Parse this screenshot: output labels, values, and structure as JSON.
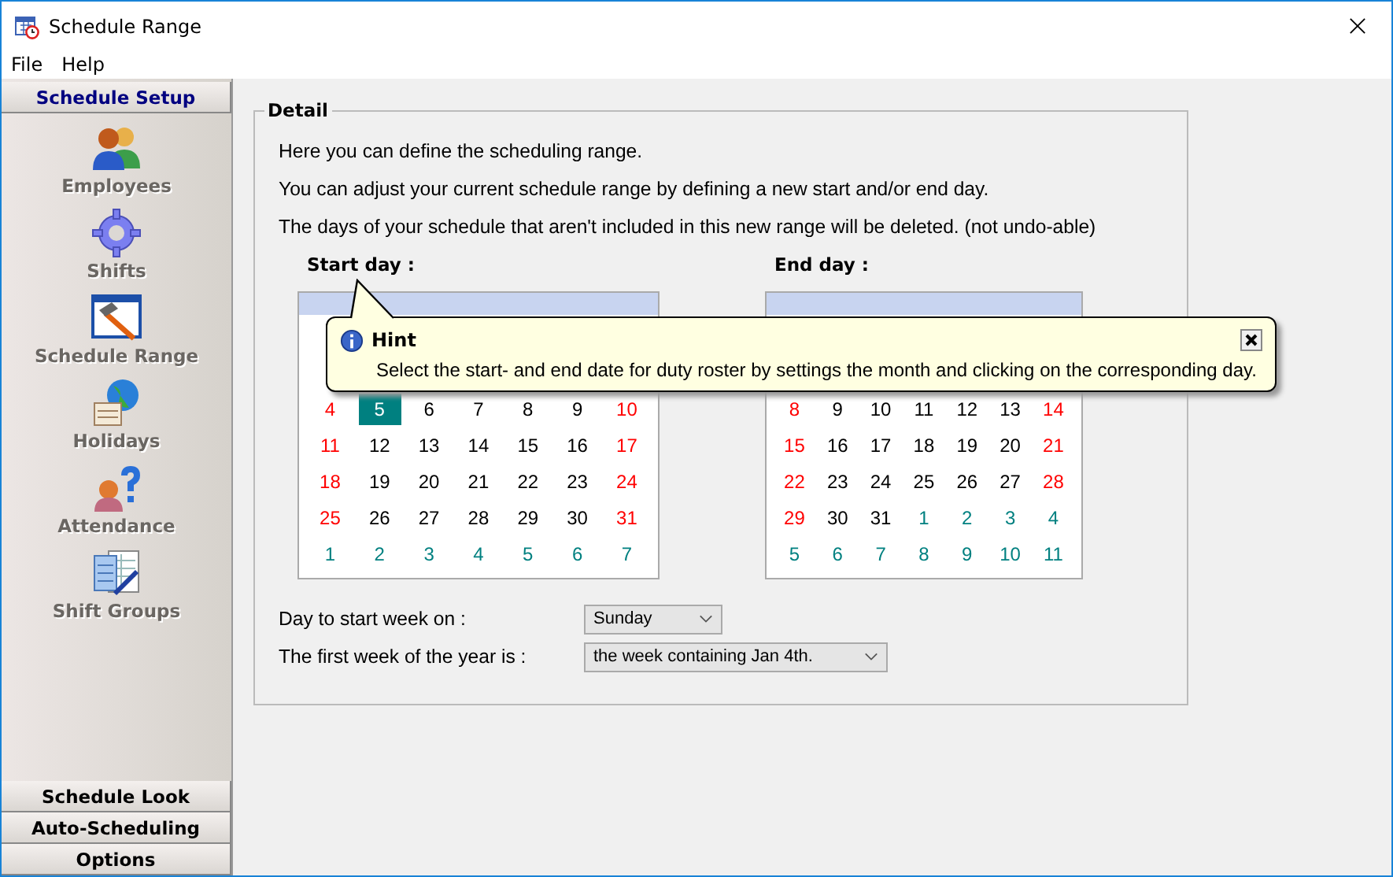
{
  "window": {
    "title": "Schedule Range"
  },
  "menu": [
    "File",
    "Help"
  ],
  "sidebar": {
    "header": "Schedule Setup",
    "items": [
      {
        "label": "Employees",
        "kind": "people"
      },
      {
        "label": "Shifts",
        "kind": "gear"
      },
      {
        "label": "Schedule Range",
        "kind": "hammer"
      },
      {
        "label": "Holidays",
        "kind": "globe"
      },
      {
        "label": "Attendance",
        "kind": "question"
      },
      {
        "label": "Shift Groups",
        "kind": "calc"
      }
    ],
    "sections": [
      "Schedule Look",
      "Auto-Scheduling",
      "Options"
    ]
  },
  "detail": {
    "title": "Detail",
    "lines": [
      "Here you can define the scheduling range.",
      "You can adjust your current schedule range by defining a new start and/or end day.",
      "The days of your schedule that aren't included in this new range will be deleted. (not undo-able)"
    ],
    "calendars": [
      {
        "label": "Start day :",
        "weeks": [
          [
            {
              "d": "4",
              "kind": "weekend",
              "selected": false
            },
            {
              "d": "5",
              "kind": "day",
              "selected": true
            },
            {
              "d": "6",
              "kind": "day",
              "selected": false
            },
            {
              "d": "7",
              "kind": "day",
              "selected": false
            },
            {
              "d": "8",
              "kind": "day",
              "selected": false
            },
            {
              "d": "9",
              "kind": "day",
              "selected": false
            },
            {
              "d": "10",
              "kind": "weekend",
              "selected": false
            }
          ],
          [
            {
              "d": "11",
              "kind": "weekend",
              "selected": false
            },
            {
              "d": "12",
              "kind": "day",
              "selected": false
            },
            {
              "d": "13",
              "kind": "day",
              "selected": false
            },
            {
              "d": "14",
              "kind": "day",
              "selected": false
            },
            {
              "d": "15",
              "kind": "day",
              "selected": false
            },
            {
              "d": "16",
              "kind": "day",
              "selected": false
            },
            {
              "d": "17",
              "kind": "weekend",
              "selected": false
            }
          ],
          [
            {
              "d": "18",
              "kind": "weekend",
              "selected": false
            },
            {
              "d": "19",
              "kind": "day",
              "selected": false
            },
            {
              "d": "20",
              "kind": "day",
              "selected": false
            },
            {
              "d": "21",
              "kind": "day",
              "selected": false
            },
            {
              "d": "22",
              "kind": "day",
              "selected": false
            },
            {
              "d": "23",
              "kind": "day",
              "selected": false
            },
            {
              "d": "24",
              "kind": "weekend",
              "selected": false
            }
          ],
          [
            {
              "d": "25",
              "kind": "weekend",
              "selected": false
            },
            {
              "d": "26",
              "kind": "day",
              "selected": false
            },
            {
              "d": "27",
              "kind": "day",
              "selected": false
            },
            {
              "d": "28",
              "kind": "day",
              "selected": false
            },
            {
              "d": "29",
              "kind": "day",
              "selected": false
            },
            {
              "d": "30",
              "kind": "day",
              "selected": false
            },
            {
              "d": "31",
              "kind": "weekend",
              "selected": false
            }
          ],
          [
            {
              "d": "1",
              "kind": "other",
              "selected": false
            },
            {
              "d": "2",
              "kind": "other",
              "selected": false
            },
            {
              "d": "3",
              "kind": "other",
              "selected": false
            },
            {
              "d": "4",
              "kind": "other",
              "selected": false
            },
            {
              "d": "5",
              "kind": "other",
              "selected": false
            },
            {
              "d": "6",
              "kind": "other",
              "selected": false
            },
            {
              "d": "7",
              "kind": "other",
              "selected": false
            }
          ]
        ]
      },
      {
        "label": "End day :",
        "weeks": [
          [
            {
              "d": "8",
              "kind": "weekend",
              "selected": false
            },
            {
              "d": "9",
              "kind": "day",
              "selected": false
            },
            {
              "d": "10",
              "kind": "day",
              "selected": false
            },
            {
              "d": "11",
              "kind": "day",
              "selected": false
            },
            {
              "d": "12",
              "kind": "day",
              "selected": false
            },
            {
              "d": "13",
              "kind": "day",
              "selected": false
            },
            {
              "d": "14",
              "kind": "weekend",
              "selected": false
            }
          ],
          [
            {
              "d": "15",
              "kind": "weekend",
              "selected": false
            },
            {
              "d": "16",
              "kind": "day",
              "selected": false
            },
            {
              "d": "17",
              "kind": "day",
              "selected": false
            },
            {
              "d": "18",
              "kind": "day",
              "selected": false
            },
            {
              "d": "19",
              "kind": "day",
              "selected": false
            },
            {
              "d": "20",
              "kind": "day",
              "selected": false
            },
            {
              "d": "21",
              "kind": "weekend",
              "selected": false
            }
          ],
          [
            {
              "d": "22",
              "kind": "weekend",
              "selected": false
            },
            {
              "d": "23",
              "kind": "day",
              "selected": false
            },
            {
              "d": "24",
              "kind": "day",
              "selected": false
            },
            {
              "d": "25",
              "kind": "day",
              "selected": false
            },
            {
              "d": "26",
              "kind": "day",
              "selected": false
            },
            {
              "d": "27",
              "kind": "day",
              "selected": false
            },
            {
              "d": "28",
              "kind": "weekend",
              "selected": false
            }
          ],
          [
            {
              "d": "29",
              "kind": "weekend",
              "selected": false
            },
            {
              "d": "30",
              "kind": "day",
              "selected": false
            },
            {
              "d": "31",
              "kind": "day",
              "selected": false
            },
            {
              "d": "1",
              "kind": "other",
              "selected": false
            },
            {
              "d": "2",
              "kind": "other",
              "selected": false
            },
            {
              "d": "3",
              "kind": "other",
              "selected": false
            },
            {
              "d": "4",
              "kind": "other",
              "selected": false
            }
          ],
          [
            {
              "d": "5",
              "kind": "other",
              "selected": false
            },
            {
              "d": "6",
              "kind": "other",
              "selected": false
            },
            {
              "d": "7",
              "kind": "other",
              "selected": false
            },
            {
              "d": "8",
              "kind": "other",
              "selected": false
            },
            {
              "d": "9",
              "kind": "other",
              "selected": false
            },
            {
              "d": "10",
              "kind": "other",
              "selected": false
            },
            {
              "d": "11",
              "kind": "other",
              "selected": false
            }
          ]
        ]
      }
    ],
    "settings": [
      {
        "label": "Day to start week on :",
        "value": "Sunday",
        "wide": false
      },
      {
        "label": "The first week of the year is :",
        "value": "the week containing Jan 4th.",
        "wide": true
      }
    ]
  },
  "hint": {
    "title": "Hint",
    "text": "Select the start- and end date for duty roster by settings the month and clicking on the corresponding day."
  }
}
